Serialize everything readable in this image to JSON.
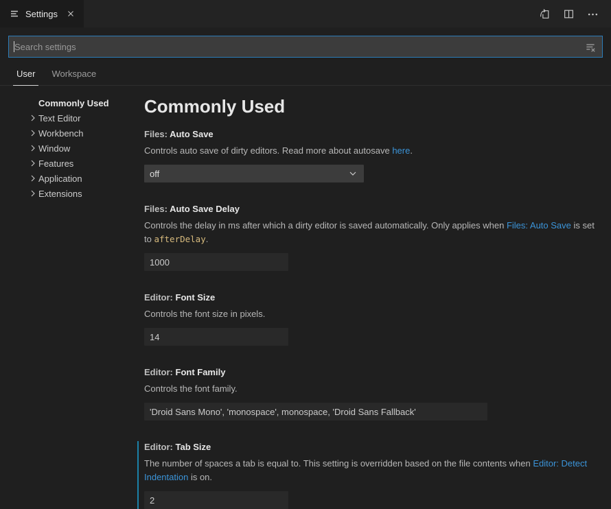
{
  "tab_bar": {
    "tab": {
      "title": "Settings"
    },
    "actions": [
      {
        "name": "open-settings-json",
        "icon": "open-settings-json-icon"
      },
      {
        "name": "split-editor",
        "icon": "split-editor-icon"
      },
      {
        "name": "more-actions",
        "icon": "ellipsis-icon"
      }
    ]
  },
  "search": {
    "placeholder": "Search settings",
    "value": "",
    "filter_icon": "filter-icon"
  },
  "scope_tabs": [
    {
      "label": "User",
      "active": true
    },
    {
      "label": "Workspace",
      "active": false
    }
  ],
  "toc": [
    {
      "label": "Commonly Used",
      "active": true,
      "expandable": false
    },
    {
      "label": "Text Editor",
      "active": false,
      "expandable": true
    },
    {
      "label": "Workbench",
      "active": false,
      "expandable": true
    },
    {
      "label": "Window",
      "active": false,
      "expandable": true
    },
    {
      "label": "Features",
      "active": false,
      "expandable": true
    },
    {
      "label": "Application",
      "active": false,
      "expandable": true
    },
    {
      "label": "Extensions",
      "active": false,
      "expandable": true
    }
  ],
  "main": {
    "heading": "Commonly Used",
    "settings": [
      {
        "category": "Files:",
        "name": "Auto Save",
        "description": [
          {
            "t": "text",
            "v": "Controls auto save of dirty editors. Read more about autosave "
          },
          {
            "t": "link",
            "v": "here"
          },
          {
            "t": "text",
            "v": "."
          }
        ],
        "control": {
          "type": "select",
          "value": "off"
        },
        "modified": false
      },
      {
        "category": "Files:",
        "name": "Auto Save Delay",
        "description": [
          {
            "t": "text",
            "v": "Controls the delay in ms after which a dirty editor is saved automatically. Only applies when "
          },
          {
            "t": "link",
            "v": "Files: Auto Save"
          },
          {
            "t": "text",
            "v": " is set to "
          },
          {
            "t": "code",
            "v": "afterDelay"
          },
          {
            "t": "text",
            "v": "."
          }
        ],
        "control": {
          "type": "input",
          "value": "1000"
        },
        "modified": false
      },
      {
        "category": "Editor:",
        "name": "Font Size",
        "description": [
          {
            "t": "text",
            "v": "Controls the font size in pixels."
          }
        ],
        "control": {
          "type": "input",
          "value": "14"
        },
        "modified": false
      },
      {
        "category": "Editor:",
        "name": "Font Family",
        "description": [
          {
            "t": "text",
            "v": "Controls the font family."
          }
        ],
        "control": {
          "type": "input",
          "value": "'Droid Sans Mono', 'monospace', monospace, 'Droid Sans Fallback'"
        },
        "modified": false
      },
      {
        "category": "Editor:",
        "name": "Tab Size",
        "description": [
          {
            "t": "text",
            "v": "The number of spaces a tab is equal to. This setting is overridden based on the file contents when "
          },
          {
            "t": "link",
            "v": "Editor: Detect Indentation"
          },
          {
            "t": "text",
            "v": " is on."
          }
        ],
        "control": {
          "type": "input",
          "value": "2"
        },
        "modified": true
      }
    ]
  },
  "colors": {
    "focus_border": "#2b7cb8",
    "link": "#3b94d9",
    "code_text": "#d7ba7d",
    "modified_indicator": "#1b81a8",
    "select_bg": "#3c3c3c",
    "input_bg": "#292929",
    "tab_strip_bg": "#232323",
    "active_tab_bg": "#1b1b1b",
    "editor_bg": "#1f1f1f"
  }
}
